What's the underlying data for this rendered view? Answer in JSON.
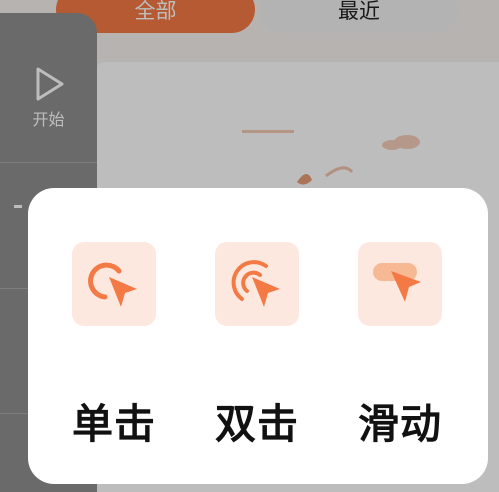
{
  "tabs": [
    {
      "label": "全部",
      "active": true
    },
    {
      "label": "最近",
      "active": false
    }
  ],
  "sidebar": {
    "items": [
      {
        "label": "开始",
        "icon": "play-icon"
      },
      {
        "label": "",
        "icon": "unknown-icon"
      },
      {
        "label": "",
        "icon": "unknown-icon"
      },
      {
        "label": "",
        "icon": "unknown-icon"
      }
    ]
  },
  "gesture_picker": {
    "options": [
      {
        "label": "单击",
        "icon": "single-tap-icon"
      },
      {
        "label": "双击",
        "icon": "double-tap-icon"
      },
      {
        "label": "滑动",
        "icon": "swipe-icon"
      }
    ]
  },
  "colors": {
    "accent": "#f47a45",
    "icon_bg": "#fde8df",
    "overlay": "rgba(0,0,0,0.26)"
  }
}
